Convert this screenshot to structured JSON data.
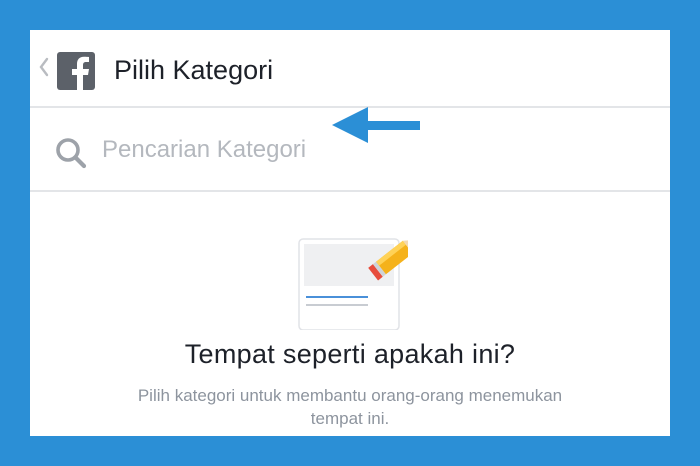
{
  "header": {
    "back_icon": "chevron-left-icon",
    "logo_icon": "facebook-logo-icon",
    "title": "Pilih Kategori"
  },
  "search": {
    "icon": "search-icon",
    "placeholder": "Pencarian Kategori",
    "value": ""
  },
  "annotation": {
    "arrow_icon": "arrow-left-icon",
    "arrow_color": "#2b8fd6"
  },
  "empty_state": {
    "illustration_icon": "document-pencil-icon",
    "heading": "Tempat seperti apakah ini?",
    "description": "Pilih kategori untuk membantu orang-orang menemukan tempat ini."
  },
  "colors": {
    "frame_border": "#2b8fd6",
    "text_primary": "#1d2129",
    "text_secondary": "#8d949e",
    "placeholder": "#b4b8be"
  }
}
